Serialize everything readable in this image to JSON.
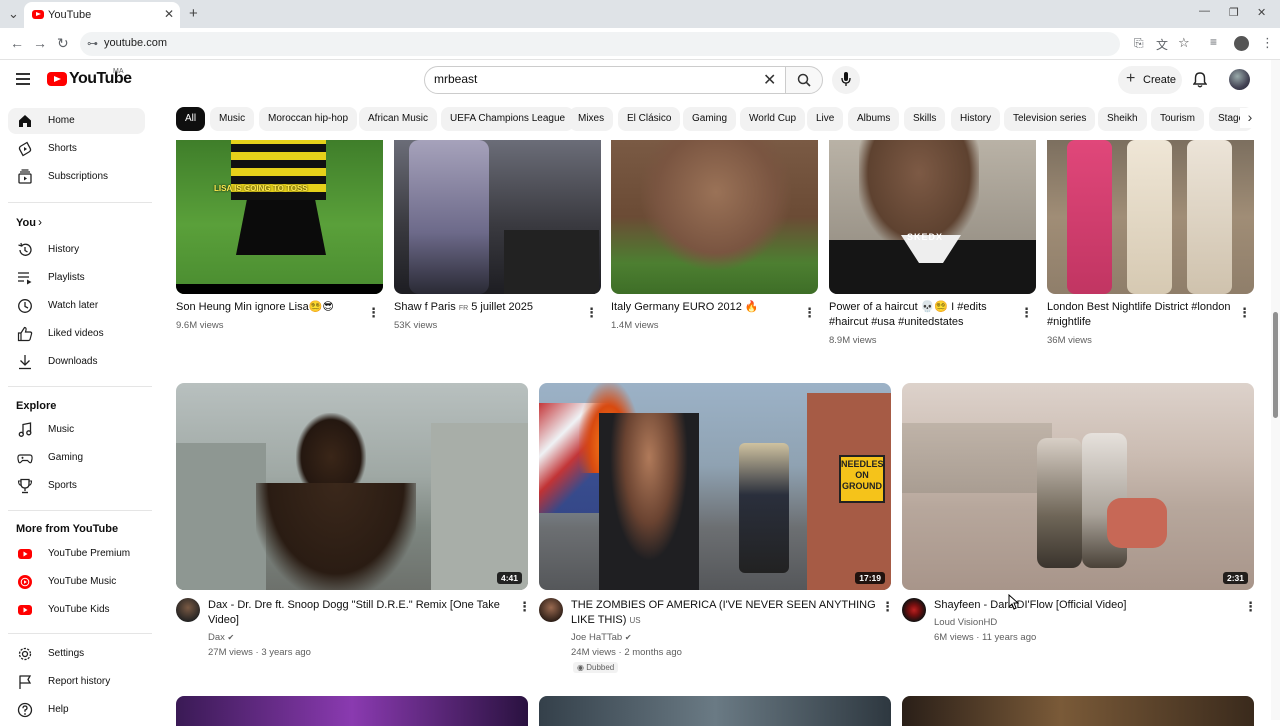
{
  "browser": {
    "tab_title": "YouTube",
    "tab_close": "✕",
    "new_tab": "+",
    "url": "youtube.com",
    "window_controls": {
      "minimize": "—",
      "restore": "❐",
      "close": "✕"
    }
  },
  "header": {
    "logo_text": "YouTube",
    "logo_country": "MA",
    "search": {
      "value": "mrbeast",
      "placeholder": "Search"
    },
    "create_label": "Create"
  },
  "chips": [
    "All",
    "Music",
    "Moroccan hip-hop",
    "African Music",
    "UEFA Champions League",
    "Mixes",
    "El Clásico",
    "Gaming",
    "World Cup",
    "Live",
    "Albums",
    "Skills",
    "History",
    "Television series",
    "Sheikh",
    "Tourism",
    "Stage"
  ],
  "sidebar": {
    "main": [
      {
        "label": "Home",
        "icon": "home-icon"
      },
      {
        "label": "Shorts",
        "icon": "shorts-icon"
      },
      {
        "label": "Subscriptions",
        "icon": "subscriptions-icon"
      }
    ],
    "you_heading": "You",
    "you": [
      {
        "label": "History",
        "icon": "history-icon"
      },
      {
        "label": "Playlists",
        "icon": "playlists-icon"
      },
      {
        "label": "Watch later",
        "icon": "watch-later-icon"
      },
      {
        "label": "Liked videos",
        "icon": "like-icon"
      },
      {
        "label": "Downloads",
        "icon": "download-icon"
      }
    ],
    "explore_heading": "Explore",
    "explore": [
      {
        "label": "Music",
        "icon": "music-icon"
      },
      {
        "label": "Gaming",
        "icon": "gaming-icon"
      },
      {
        "label": "Sports",
        "icon": "trophy-icon"
      }
    ],
    "more_heading": "More from YouTube",
    "more": [
      {
        "label": "YouTube Premium",
        "icon": "youtube-premium-icon"
      },
      {
        "label": "YouTube Music",
        "icon": "youtube-music-icon"
      },
      {
        "label": "YouTube Kids",
        "icon": "youtube-kids-icon"
      }
    ],
    "bottom": [
      {
        "label": "Settings",
        "icon": "settings-icon"
      },
      {
        "label": "Report history",
        "icon": "flag-icon"
      },
      {
        "label": "Help",
        "icon": "help-icon"
      }
    ]
  },
  "shorts": [
    {
      "title": "Son Heung Min ignore Lisa😵‍💫😎",
      "views": "9.6M views",
      "overlay_text": "LISA IS GOING TO TOSS"
    },
    {
      "title": "Shaw f Paris",
      "title_suffix": "FR",
      "title_rest": " 5 juillet 2025",
      "views": "53K views"
    },
    {
      "title": "Italy Germany EURO 2012 🔥",
      "views": "1.4M views"
    },
    {
      "title": "Power of a haircut 💀😵‍💫 I #edits #haircut #usa #unitedstates",
      "views": "8.9M views",
      "overlay_text": "SKEDX"
    },
    {
      "title": "London Best Nightlife District #london #nightlife",
      "views": "36M views"
    }
  ],
  "videos": [
    {
      "title": "Dax - Dr. Dre ft. Snoop Dogg \"Still D.R.E.\" Remix [One Take Video]",
      "channel": "Dax",
      "verified": true,
      "stats": "27M views · 3 years ago",
      "duration": "4:41"
    },
    {
      "title": "THE ZOMBIES OF AMERICA (I'VE NEVER SEEN ANYTHING LIKE THIS)",
      "title_suffix": "US",
      "channel": "Joe HaTTab",
      "verified": true,
      "stats": "24M views · 2 months ago",
      "duration": "17:19",
      "badge": "Dubbed",
      "sign_text": "NEEDLES ON GROUND"
    },
    {
      "title": "Shayfeen - Dars DI'Flow [Official Video]",
      "channel": "Loud VisionHD",
      "verified": false,
      "stats": "6M views · 11 years ago",
      "duration": "2:31"
    }
  ]
}
